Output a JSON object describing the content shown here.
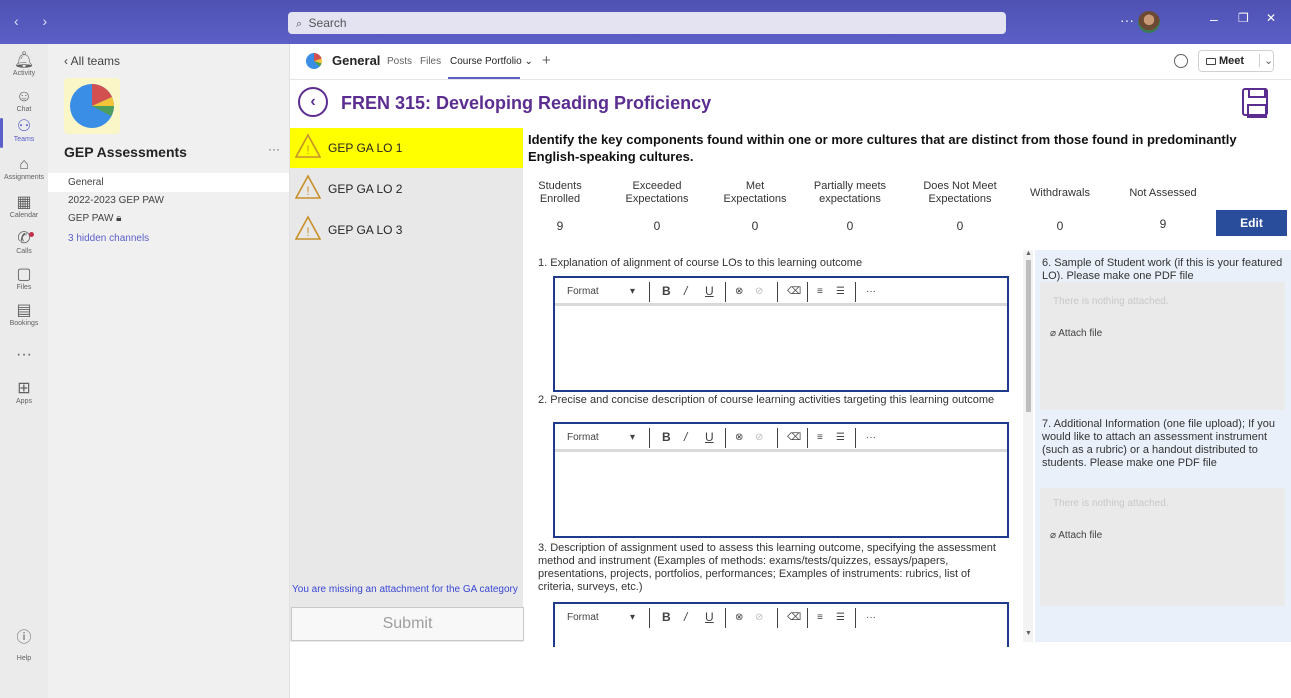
{
  "titlebar": {
    "nav_arrows": "‹ ›",
    "search_placeholder": "Search",
    "more": "···",
    "win_min": "–",
    "win_restore": "❐",
    "win_close": "✕"
  },
  "rail": {
    "items": [
      {
        "icon": "bell-icon",
        "label": "Activity",
        "glyph": "🔔︎"
      },
      {
        "icon": "chat-icon",
        "label": "Chat",
        "glyph": "☺︎"
      },
      {
        "icon": "teams-icon",
        "label": "Teams",
        "glyph": "⚇"
      },
      {
        "icon": "assignments-icon",
        "label": "Assignments",
        "glyph": "⌂"
      },
      {
        "icon": "calendar-icon",
        "label": "Calendar",
        "glyph": "▦"
      },
      {
        "icon": "calls-icon",
        "label": "Calls",
        "glyph": "✆"
      },
      {
        "icon": "files-icon",
        "label": "Files",
        "glyph": "▢"
      },
      {
        "icon": "bookings-icon",
        "label": "Bookings",
        "glyph": "▤"
      },
      {
        "icon": "more-icon",
        "label": "",
        "glyph": "···"
      },
      {
        "icon": "apps-icon",
        "label": "Apps",
        "glyph": "⊞"
      }
    ],
    "help_label": "Help"
  },
  "team": {
    "back_label": "All teams",
    "name": "GEP Assessments",
    "more": "···",
    "channels": [
      {
        "label": "General"
      },
      {
        "label": "2022-2023 GEP PAW"
      },
      {
        "label": "GEP PAW 🔒︎"
      },
      {
        "label": "3 hidden channels"
      }
    ]
  },
  "channel_header": {
    "name": "General",
    "tabs": [
      "Posts",
      "Files",
      "Course Portfolio ⌄"
    ],
    "add": "+",
    "meet_label": "Meet",
    "meet_dropdown": "⌄"
  },
  "app": {
    "back_glyph": "‹",
    "title": "FREN 315: Developing Reading Proficiency",
    "lo_items": [
      "GEP GA LO 1",
      "GEP GA LO 2",
      "GEP GA LO 3"
    ],
    "missing_text": "You are missing an attachment for the GA category",
    "submit_label": "Submit",
    "ga_question": "Identify the key components found within one or more cultures that are distinct from those found in predominantly English-speaking cultures.",
    "stats": {
      "headers": [
        "Students\nEnrolled",
        "Exceeded\nExpectations",
        "Met\nExpectations",
        "Partially meets\nexpectations",
        "Does Not Meet\nExpectations",
        "Withdrawals",
        "Not Assessed"
      ],
      "values": [
        "9",
        "0",
        "0",
        "0",
        "0",
        "0",
        "9"
      ]
    },
    "edit_label": "Edit",
    "questions": [
      "1. Explanation of alignment of course LOs to this learning outcome",
      "2. Precise and concise description of course learning activities targeting this learning outcome",
      "3. Description of assignment used to assess this learning outcome, specifying the assessment method and instrument (Examples of methods:  exams/tests/quizzes, essays/papers, presentations, projects, portfolios, performances; Examples of instruments: rubrics, list of criteria, surveys, etc.)"
    ],
    "rte_toolbar": {
      "format": "Format",
      "caret": "▾",
      "bold": "B",
      "italic": "/",
      "underline": "U",
      "more": "···"
    },
    "attachments": [
      {
        "title": "6. Sample of Student work (if this is your featured LO). Please make one PDF file",
        "empty": "There is nothing attached.",
        "button": "Attach file"
      },
      {
        "title": "7. Additional Information (one file upload); If you would like to attach an assessment instrument (such as a rubric) or a handout distributed to students. Please make one PDF file",
        "empty": "There is nothing attached.",
        "button": "Attach file"
      }
    ]
  },
  "colors": {
    "teams_purple": "#5b5fc7",
    "title_purple": "#5c2d91",
    "lo_selected": "#ffff00",
    "edit_blue": "#2a4d9b",
    "warn_orange": "#c8902a"
  }
}
